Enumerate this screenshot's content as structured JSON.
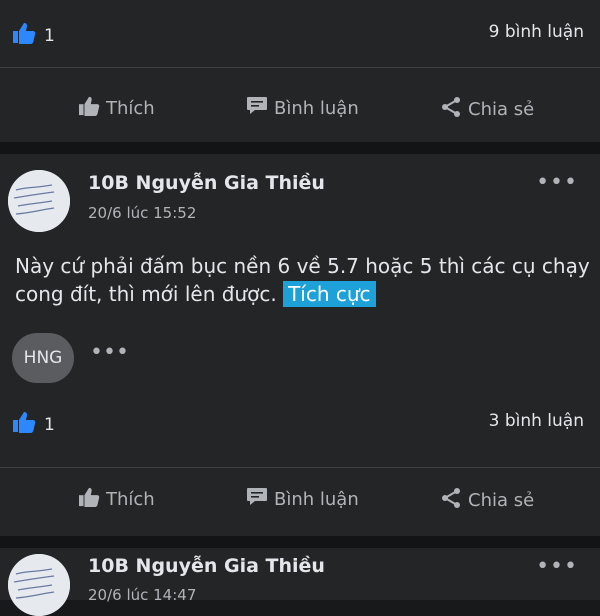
{
  "post1": {
    "like_count": "1",
    "comment_count": "9 bình luận",
    "actions": {
      "like": "Thích",
      "comment": "Bình luận",
      "share": "Chia sẻ"
    }
  },
  "post2": {
    "author": "10B Nguyễn Gia Thiều",
    "time": "20/6 lúc 15:52",
    "text": "Này cứ phải đấm bục nền 6 về 5.7 hoặc 5 thì các cụ chạy cong đít, thì mới lên được.",
    "tag": "Tích cực",
    "reactor_initials": "HNG",
    "like_count": "1",
    "comment_count": "3 bình luận",
    "actions": {
      "like": "Thích",
      "comment": "Bình luận",
      "share": "Chia sẻ"
    }
  },
  "post3": {
    "author": "10B Nguyễn Gia Thiều",
    "time": "20/6 lúc 14:47"
  },
  "colors": {
    "background": "#242526",
    "page": "#18191a",
    "tag": "#1da1d8",
    "like_icon": "#2d88ff"
  },
  "icons": [
    "like-thumb-icon",
    "thumb-outline-icon",
    "comment-bubble-icon",
    "share-icon",
    "more-options-icon"
  ]
}
